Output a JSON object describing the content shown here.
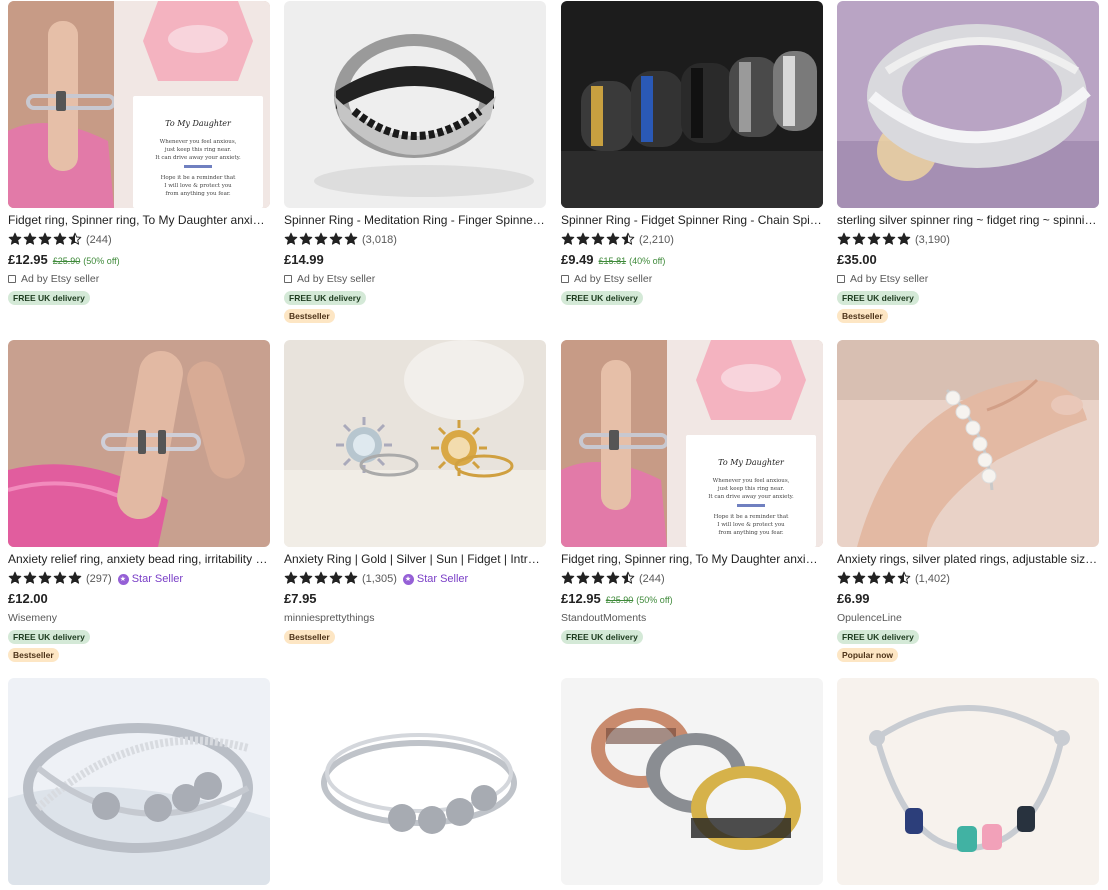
{
  "colors": {
    "free_badge": "#d4e9d7",
    "bestseller_badge": "#fde6c4",
    "discount_text": "#3f8a3a",
    "star_seller": "#7a3fc7"
  },
  "listings": [
    {
      "title": "Fidget ring, Spinner ring, To My Daughter anxiety ring",
      "rating": 4.5,
      "review_count": "(244)",
      "price": "£12.95",
      "original_price": "£25.90",
      "discount": "(50% off)",
      "shop": "Ad by Etsy seller",
      "is_ad": true,
      "star_seller": false,
      "badges": [
        "FREE UK delivery"
      ],
      "image": "ring-on-finger-with-daughter-card"
    },
    {
      "title": "Spinner Ring - Meditation Ring - Finger Spinner Ring",
      "rating": 5,
      "review_count": "(3,018)",
      "price": "£14.99",
      "original_price": "",
      "discount": "",
      "shop": "Ad by Etsy seller",
      "is_ad": true,
      "star_seller": false,
      "badges": [
        "FREE UK delivery",
        "Bestseller"
      ],
      "image": "silver-ring-black-chain"
    },
    {
      "title": "Spinner Ring - Fidget Spinner Ring - Chain Spinner Ring",
      "rating": 4.5,
      "review_count": "(2,210)",
      "price": "£9.49",
      "original_price": "£15.81",
      "discount": "(40% off)",
      "shop": "Ad by Etsy seller",
      "is_ad": true,
      "star_seller": false,
      "badges": [
        "FREE UK delivery"
      ],
      "image": "chain-rings-row"
    },
    {
      "title": "sterling silver spinner ring ~ fidget ring ~ spinning ring",
      "rating": 5,
      "review_count": "(3,190)",
      "price": "£35.00",
      "original_price": "",
      "discount": "",
      "shop": "Ad by Etsy seller",
      "is_ad": true,
      "star_seller": false,
      "badges": [
        "FREE UK delivery",
        "Bestseller"
      ],
      "image": "sterling-silver-wide-ring"
    },
    {
      "title": "Anxiety relief ring, anxiety bead ring, irritability ring",
      "rating": 5,
      "review_count": "(297)",
      "price": "£12.00",
      "original_price": "",
      "discount": "",
      "shop": "Wisemeny",
      "is_ad": false,
      "star_seller": true,
      "star_seller_label": "Star Seller",
      "badges": [
        "FREE UK delivery",
        "Bestseller"
      ],
      "image": "ring-on-finger-pink-sleeve"
    },
    {
      "title": "Anxiety Ring | Gold | Silver | Sun | Fidget | Introvert",
      "rating": 5,
      "review_count": "(1,305)",
      "price": "£7.95",
      "original_price": "",
      "discount": "",
      "shop": "minniesprettythings",
      "is_ad": false,
      "star_seller": true,
      "star_seller_label": "Star Seller",
      "badges": [
        "Bestseller"
      ],
      "image": "sun-rings-pair"
    },
    {
      "title": "Fidget ring, Spinner ring, To My Daughter anxiety ring",
      "rating": 4.5,
      "review_count": "(244)",
      "price": "£12.95",
      "original_price": "£25.90",
      "discount": "(50% off)",
      "shop": "StandoutMoments",
      "is_ad": false,
      "star_seller": false,
      "badges": [
        "FREE UK delivery"
      ],
      "image": "ring-on-finger-with-daughter-card"
    },
    {
      "title": "Anxiety rings, silver plated rings, adjustable size rings",
      "rating": 4.5,
      "review_count": "(1,402)",
      "price": "£6.99",
      "original_price": "",
      "discount": "",
      "shop": "OpulenceLine",
      "is_ad": false,
      "star_seller": false,
      "badges": [
        "FREE UK delivery",
        "Popular now"
      ],
      "image": "pearl-bead-ring-on-finger"
    },
    {
      "title": "",
      "image": "silver-bead-wave-ring"
    },
    {
      "title": "",
      "image": "silver-four-bead-ring"
    },
    {
      "title": "",
      "image": "moon-star-spinner-rings"
    },
    {
      "title": "",
      "image": "open-cuff-colored-beads-ring"
    }
  ]
}
